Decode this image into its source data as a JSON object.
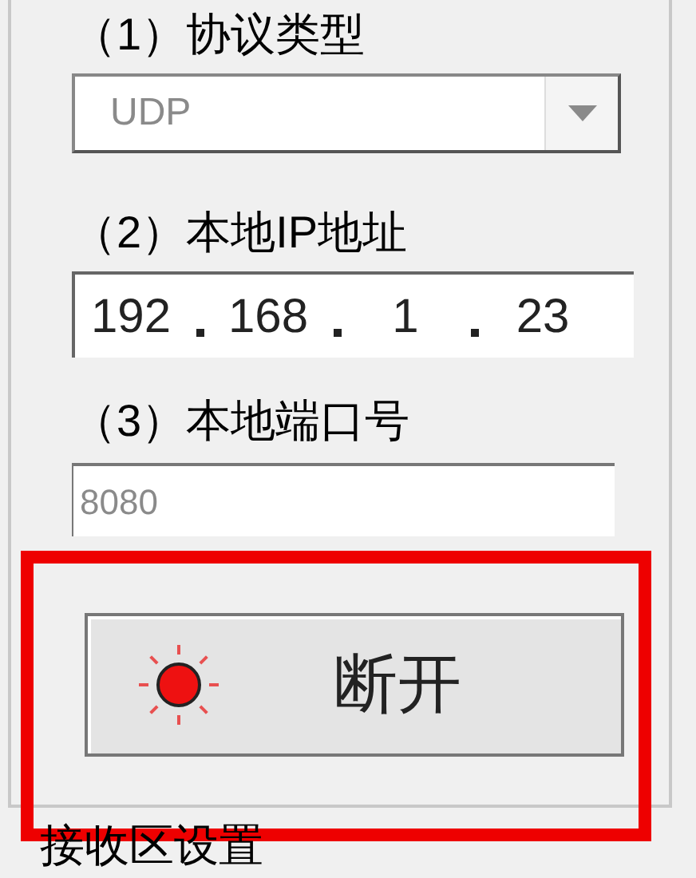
{
  "settings": {
    "protocol": {
      "label": "（1）协议类型",
      "value": "UDP",
      "disabled": true
    },
    "local_ip": {
      "label": "（2）本地IP地址",
      "octets": [
        "192",
        "168",
        "1",
        "23"
      ]
    },
    "local_port": {
      "label": "（3）本地端口号",
      "value": "8080",
      "disabled": true
    },
    "connect_button": {
      "label": "断开",
      "led_on": true
    }
  },
  "annotation": {
    "kind": "highlight",
    "color": "#ee0000"
  },
  "next_section": {
    "label": "接收区设置"
  }
}
